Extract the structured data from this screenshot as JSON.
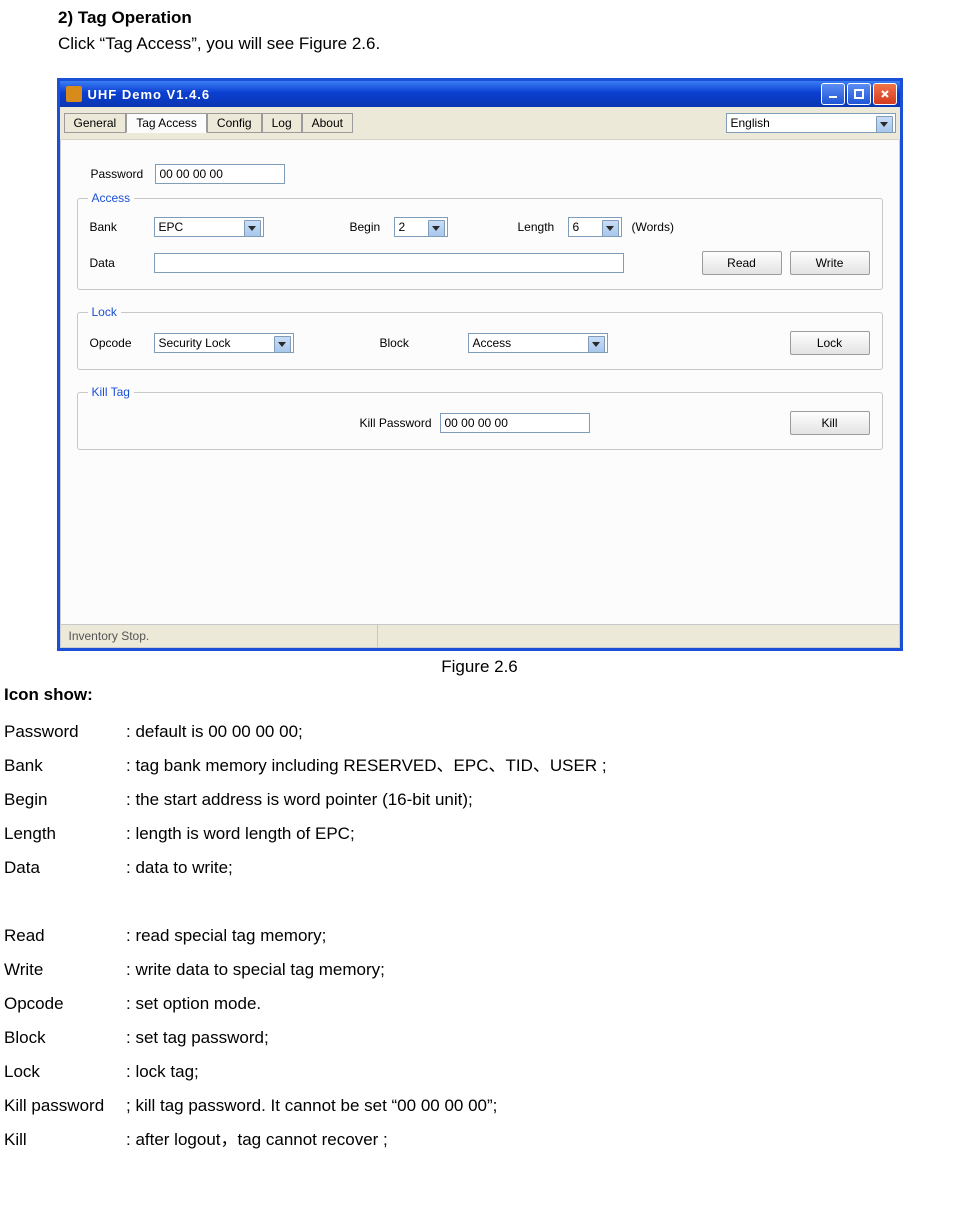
{
  "doc": {
    "heading": "2) Tag Operation",
    "intro": "Click “Tag Access”, you will see Figure 2.6.",
    "caption": "Figure 2.6",
    "icon_show_heading": "Icon show:",
    "defs": [
      {
        "k": "Password",
        "v": ": default is 00 00 00 00;"
      },
      {
        "k": "Bank",
        "v": ": tag bank memory including RESERVED、EPC、TID、USER ;"
      },
      {
        "k": "Begin",
        "v": ": the start address is word pointer (16-bit unit);"
      },
      {
        "k": "Length",
        "v": ": length is word length of EPC;"
      },
      {
        "k": "Data",
        "v": ": data to write;"
      },
      {
        "k": "",
        "v": ""
      },
      {
        "k": "Read",
        "v": ": read special tag memory;"
      },
      {
        "k": "Write",
        "v": ": write data to special tag memory;"
      },
      {
        "k": "Opcode",
        "v": "        : set option mode."
      },
      {
        "k": "Block",
        "v": ": set tag password;"
      },
      {
        "k": "Lock",
        "v": ": lock tag;"
      },
      {
        "k": "Kill password",
        "v": "; kill tag password. It cannot be set “00 00 00 00”;"
      },
      {
        "k": "Kill",
        "v": ": after logout，tag cannot recover ;"
      }
    ]
  },
  "win": {
    "title": "UHF Demo V1.4.6",
    "tabs": [
      "General",
      "Tag Access",
      "Config",
      "Log",
      "About"
    ],
    "active_tab": 1,
    "language": "English",
    "password_label": "Password",
    "password_value": "00 00 00 00",
    "access": {
      "legend": "Access",
      "bank_label": "Bank",
      "bank_value": "EPC",
      "begin_label": "Begin",
      "begin_value": "2",
      "length_label": "Length",
      "length_value": "6",
      "length_unit": "(Words)",
      "data_label": "Data",
      "data_value": "",
      "read_btn": "Read",
      "write_btn": "Write"
    },
    "lock": {
      "legend": "Lock",
      "opcode_label": "Opcode",
      "opcode_value": "Security Lock",
      "block_label": "Block",
      "block_value": "Access",
      "lock_btn": "Lock"
    },
    "kill": {
      "legend": "Kill Tag",
      "kpw_label": "Kill Password",
      "kpw_value": "00 00 00 00",
      "kill_btn": "Kill"
    },
    "status": "Inventory Stop."
  }
}
